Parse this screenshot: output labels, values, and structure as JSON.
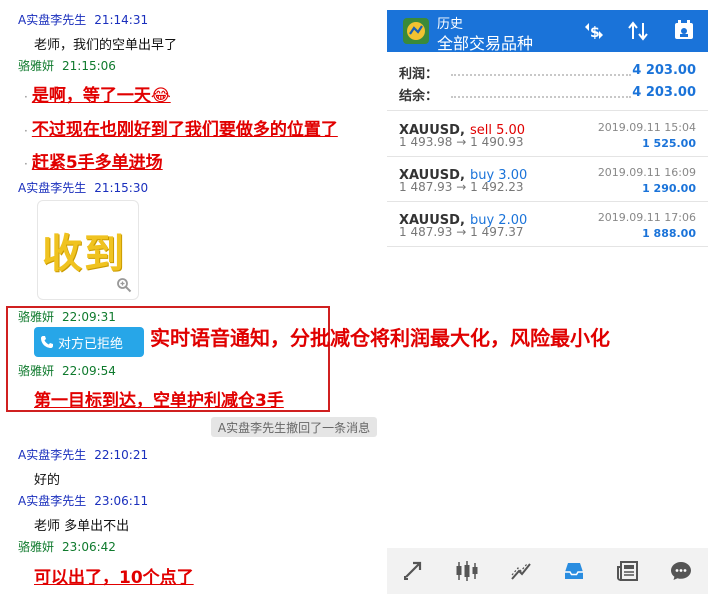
{
  "chat": {
    "m1": {
      "sender": "A实盘李先生",
      "time": "21:14:31",
      "text": "老师，我们的空单出早了"
    },
    "m2": {
      "sender": "骆雅妍",
      "time": "21:15:06",
      "lines": [
        "是啊，等了一天😂",
        "不过现在也刚好到了我们要做多的位置了",
        "赶紧5手多单进场"
      ]
    },
    "m3": {
      "sender": "A实盘李先生",
      "time": "21:15:30",
      "sticker_text": "收到"
    },
    "m4": {
      "sender": "骆雅妍",
      "time": "22:09:31",
      "call_label": "对方已拒绝"
    },
    "m5": {
      "sender": "骆雅妍",
      "time": "22:09:54",
      "text": "第一目标到达，空单护利减仓3手"
    },
    "recall_notice": "A实盘李先生撤回了一条消息",
    "m6": {
      "sender": "A实盘李先生",
      "time": "22:10:21",
      "text": "好的"
    },
    "m7": {
      "sender": "A实盘李先生",
      "time": "23:06:11",
      "text": "老师 多单出不出"
    },
    "m8": {
      "sender": "骆雅妍",
      "time": "23:06:42",
      "text": "可以出了，10个点了"
    }
  },
  "annotation": "实时语音通知，分批减仓将利润最大化，风险最小化",
  "mt4": {
    "header": {
      "small": "历史",
      "big": "全部交易品种"
    },
    "summary": [
      {
        "label": "利润：",
        "value": "4 203.00"
      },
      {
        "label": "结余：",
        "value": "4 203.00"
      }
    ],
    "trades": [
      {
        "symbol": "XAUUSD,",
        "side": "sell 5.00",
        "side_type": "sell",
        "prices": "1 493.98 → 1 490.93",
        "date": "2019.09.11 15:04",
        "profit": "1 525.00"
      },
      {
        "symbol": "XAUUSD,",
        "side": "buy 3.00",
        "side_type": "buy",
        "prices": "1 487.93 → 1 492.23",
        "date": "2019.09.11 16:09",
        "profit": "1 290.00"
      },
      {
        "symbol": "XAUUSD,",
        "side": "buy 2.00",
        "side_type": "buy",
        "prices": "1 487.93 → 1 497.37",
        "date": "2019.09.11 17:06",
        "profit": "1 888.00"
      }
    ],
    "bottom_icons": [
      "quotes-icon",
      "chart-icon",
      "trade-icon",
      "history-icon",
      "news-icon",
      "chat-icon"
    ]
  }
}
